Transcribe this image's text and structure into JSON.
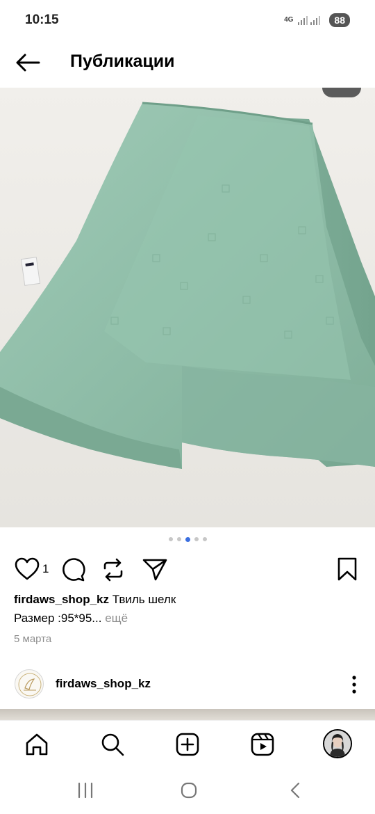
{
  "status_bar": {
    "time": "10:15",
    "network": "4G",
    "battery": "88"
  },
  "header": {
    "title": "Публикации",
    "back_icon": "arrow-left-icon"
  },
  "post": {
    "image_description_icon": "photo",
    "carousel": {
      "total": 5,
      "active_index": 2
    },
    "likes": "1",
    "username": "firdaws_shop_kz",
    "caption_text": " Твиль шелк",
    "caption_line2": "Размер :95*95...",
    "more_label": " ещё",
    "date": "5 марта"
  },
  "next_post": {
    "username": "firdaws_shop_kz"
  },
  "bottom_nav": {
    "items": [
      "home-icon",
      "search-icon",
      "create-post-icon",
      "reels-icon",
      "profile-avatar"
    ]
  },
  "colors": {
    "accent": "#3b6fe0",
    "scarf": "#8ebea9",
    "muted": "#8e8e8e"
  }
}
